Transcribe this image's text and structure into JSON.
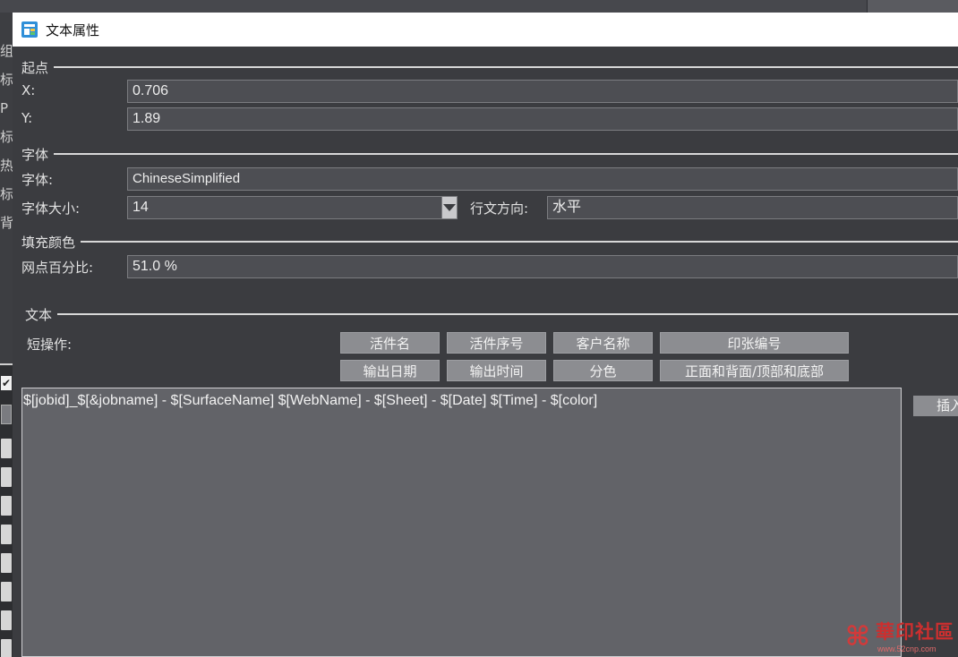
{
  "background_app": {
    "left_labels": [
      "组",
      "标",
      "P",
      "标",
      "热",
      "标",
      "背"
    ],
    "checkbox_mark": "✔"
  },
  "dialog": {
    "title": "文本属性",
    "sections": {
      "origin": "起点",
      "font": "字体",
      "fill_color": "填充颜色",
      "text": "文本"
    },
    "origin": {
      "x_label": "X:",
      "x_value": "0.706",
      "y_label": "Y:",
      "y_value": "1.89"
    },
    "font": {
      "font_label": "字体:",
      "font_value": "ChineseSimplified",
      "size_label": "字体大小:",
      "size_value": "14",
      "direction_label": "行文方向:",
      "direction_value": "水平"
    },
    "fill": {
      "dot_percent_label": "网点百分比:",
      "dot_percent_value": "51.0 %"
    },
    "text": {
      "shortcut_label": "短操作:",
      "shortcut_buttons_row1": [
        "活件名",
        "活件序号",
        "客户名称",
        "印张编号"
      ],
      "shortcut_buttons_row2": [
        "输出日期",
        "输出时间",
        "分色",
        "正面和背面/顶部和底部"
      ],
      "content": "$[jobid]_$[&jobname] - $[SurfaceName]  $[WebName] - $[Sheet] - $[Date] $[Time] - $[color]",
      "insert_label": "插入"
    }
  },
  "watermark": {
    "logo": "⌘",
    "name": "華印社區",
    "url": "www.52cnp.com"
  },
  "colors": {
    "dialog_bg": "#3b3c40",
    "field_bg": "#4d4e53",
    "button_bg": "#8c8d91",
    "textarea_bg": "#626368",
    "titlebar_bg": "#ffffff"
  }
}
